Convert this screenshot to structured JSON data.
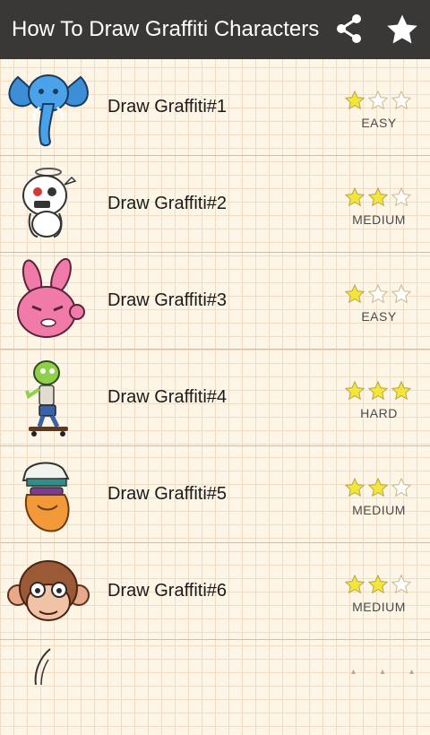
{
  "app": {
    "title": "How To Draw Graffiti Characters",
    "share_icon": "share-icon",
    "favorite_icon": "star-icon"
  },
  "colors": {
    "appbar": "#3a3836",
    "star_fill": "#f3e63a",
    "star_outline": "#c9b78a",
    "divider": "#c9bfb1"
  },
  "items": [
    {
      "label": "Draw Graffiti#1",
      "difficulty": "EASY",
      "stars": 1,
      "max_stars": 3,
      "thumbnail": "blue-elephant"
    },
    {
      "label": "Draw Graffiti#2",
      "difficulty": "MEDIUM",
      "stars": 2,
      "max_stars": 3,
      "thumbnail": "white-ghost-bunny"
    },
    {
      "label": "Draw Graffiti#3",
      "difficulty": "EASY",
      "stars": 1,
      "max_stars": 3,
      "thumbnail": "pink-bunny"
    },
    {
      "label": "Draw Graffiti#4",
      "difficulty": "HARD",
      "stars": 3,
      "max_stars": 3,
      "thumbnail": "zombie-skateboarder"
    },
    {
      "label": "Draw Graffiti#5",
      "difficulty": "MEDIUM",
      "stars": 2,
      "max_stars": 3,
      "thumbnail": "bearded-man-cap"
    },
    {
      "label": "Draw Graffiti#6",
      "difficulty": "MEDIUM",
      "stars": 2,
      "max_stars": 3,
      "thumbnail": "monkey-face"
    }
  ]
}
